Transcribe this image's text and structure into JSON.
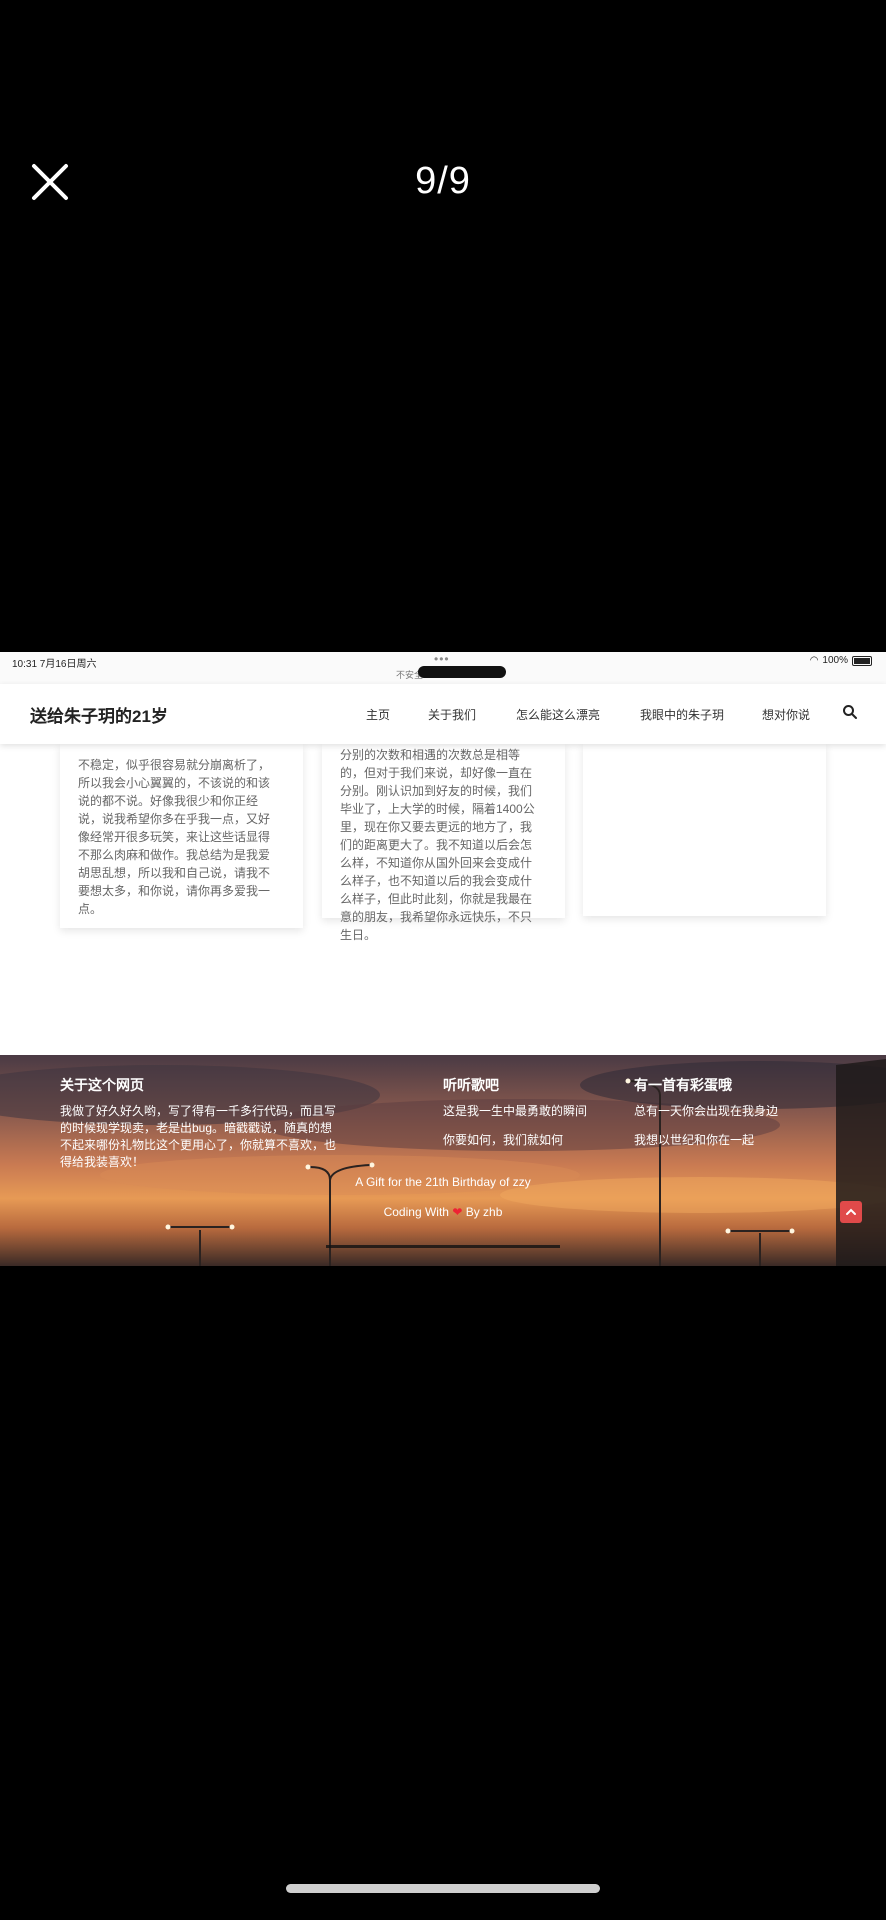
{
  "viewer": {
    "counter": "9/9",
    "close_icon": "close-icon"
  },
  "status_bar": {
    "time": "10:31  7月16日周六",
    "url": "不安全",
    "battery": "100%"
  },
  "site": {
    "title": "送给朱子玥的21岁",
    "nav": [
      "主页",
      "关于我们",
      "怎么能这么漂亮",
      "我眼中的朱子玥",
      "想对你说"
    ],
    "search_icon": "search-icon"
  },
  "cards": [
    {
      "lines": [
        "不稳定，似乎很容易就分崩离析了，",
        "所以我会小心翼翼的，不该说的和该",
        "说的都不说。好像我很少和你正经",
        "说，说我希望你多在乎我一点，又好",
        "像经常开很多玩笑，来让这些话显得",
        "不那么肉麻和做作。我总结为是我爱",
        "胡思乱想，所以我和自己说，请我不",
        "要想太多，和你说，请你再多爱我一",
        "点。"
      ]
    },
    {
      "lines": [
        "分别的次数和相遇的次数总是相等",
        "的，但对于我们来说，却好像一直在",
        "分别。刚认识加到好友的时候，我们",
        "毕业了，上大学的时候，隔着1400公",
        "里，现在你又要去更远的地方了，我",
        "们的距离更大了。我不知道以后会怎",
        "么样，不知道你从国外回来会变成什",
        "么样子，也不知道以后的我会变成什",
        "么样子，但此时此刻，你就是我最在",
        "意的朋友，我希望你永远快乐，不只",
        "生日。"
      ]
    },
    {
      "lines": []
    }
  ],
  "footer": {
    "about_title": "关于这个网页",
    "about_lines": [
      "我做了好久好久哟，写了得有一千多行代码，而且写",
      "的时候现学现卖，老是出bug。暗戳戳说，随真的想",
      "不起来哪份礼物比这个更用心了，你就算不喜欢，也",
      "得给我装喜欢！"
    ],
    "music_title": "听听歌吧",
    "music_lines": [
      "这是我一生中最勇敢的瞬间",
      "你要如何，我们就如何"
    ],
    "egg_title": "有一首有彩蛋哦",
    "egg_lines": [
      "总有一天你会出现在我身边",
      "我想以世纪和你在一起"
    ],
    "gift_line": "A Gift for the 21th Birthday of zzy",
    "coding_prefix": "Coding With",
    "coding_suffix": "By zhb",
    "to_top_icon": "chevron-up-icon"
  }
}
